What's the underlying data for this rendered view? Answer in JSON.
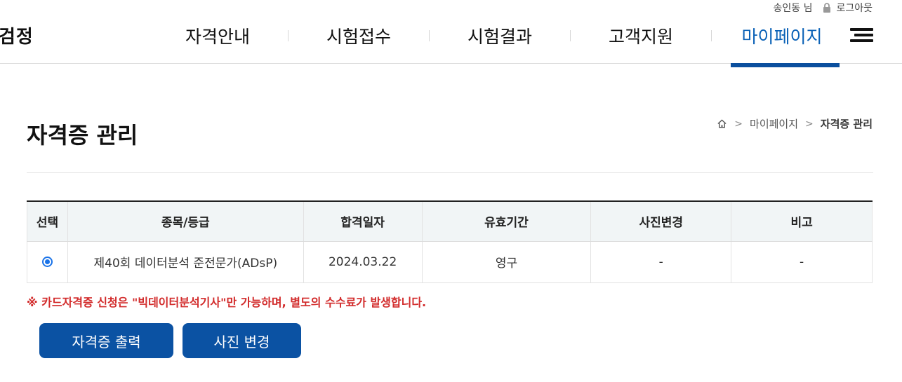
{
  "header": {
    "user_name": "송인동 님",
    "logout_label": "로그아웃",
    "logo_text": "검정",
    "nav": [
      {
        "label": "자격안내"
      },
      {
        "label": "시험접수"
      },
      {
        "label": "시험결과"
      },
      {
        "label": "고객지원"
      },
      {
        "label": "마이페이지",
        "active": true
      }
    ],
    "menu_icon": "hamburger-menu-icon"
  },
  "page": {
    "title": "자격증 관리",
    "breadcrumb": {
      "home_icon": "home-icon",
      "items": [
        "마이페이지",
        "자격증 관리"
      ]
    }
  },
  "table": {
    "headers": [
      "선택",
      "종목/등급",
      "합격일자",
      "유효기간",
      "사진변경",
      "비고"
    ],
    "rows": [
      {
        "selected": true,
        "subject": "제40회 데이터분석 준전문가(ADsP)",
        "pass_date": "2024.03.22",
        "validity": "영구",
        "photo_change": "-",
        "note": "-"
      }
    ]
  },
  "notice": "※ 카드자격증 신청은 \"빅데이터분석기사\"만 가능하며, 별도의 수수료가 발생합니다.",
  "buttons": {
    "print_label": "자격증 출력",
    "photo_label": "사진 변경"
  },
  "colors": {
    "accent": "#0b62b7",
    "button": "#0b52a3",
    "notice": "#d22b2b",
    "radio": "#1a73e8"
  }
}
